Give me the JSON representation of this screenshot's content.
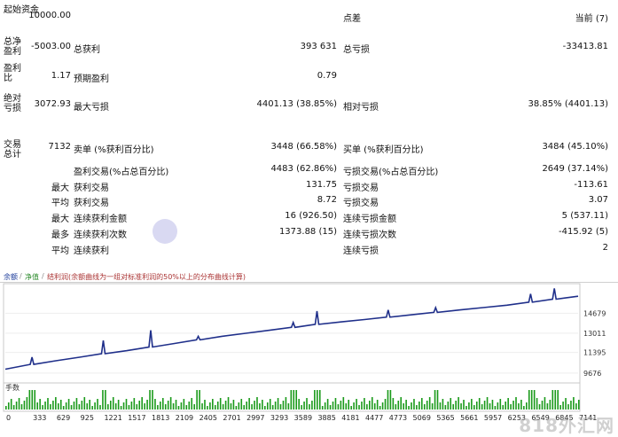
{
  "report": {
    "rows": [
      {
        "label": "起始资金",
        "value": "10000.00",
        "label2": "点差",
        "value2": "当前 (7)"
      },
      {
        "label": "总净盈利",
        "value": "-5003.00",
        "mid_label": "总获利",
        "mid_value": "393 631",
        "label2": "总亏损",
        "value2": "-33413.81"
      },
      {
        "label": "盈利比",
        "value": "1.17",
        "mid_label": "预期盈利",
        "mid_value": "0.79"
      },
      {
        "label": "绝对亏损",
        "value": "3072.93",
        "mid_label": "最大亏损",
        "mid_value": "4401.13 (38.85%)",
        "label2": "相对亏损",
        "value2": "38.85% (4401.13)"
      },
      {
        "label": "交易总计",
        "value": "7132",
        "mid_label": "卖单 (%获利百分比)",
        "mid_value": "3448 (66.58%)",
        "label2": "买单 (%获利百分比)",
        "value2": "3484 (45.10%)"
      }
    ],
    "trade_rows": [
      {
        "prefix": "",
        "mid_label": "盈利交易(%占总百分比)",
        "mid_value": "4483 (62.86%)",
        "label2": "亏损交易(%占总百分比)",
        "value2": "2649 (37.14%)"
      },
      {
        "prefix": "最大",
        "mid_label": "获利交易",
        "mid_value": "131.75",
        "label2": "亏损交易",
        "value2": "-113.61"
      },
      {
        "prefix": "平均",
        "mid_label": "获利交易",
        "mid_value": "8.72",
        "label2": "亏损交易",
        "value2": "3.07"
      },
      {
        "prefix": "最大",
        "mid_label": "连续获利金额",
        "mid_value": "16 (926.50)",
        "label2": "连续亏损金额",
        "value2": "5 (537.11)"
      },
      {
        "prefix": "最多",
        "mid_label": "连续获利次数",
        "mid_value": "1373.88 (15)",
        "label2": "连续亏损次数",
        "value2": "-415.92 (5)"
      },
      {
        "prefix": "平均",
        "mid_label": "连续获利",
        "mid_value": "",
        "label2": "连续亏损",
        "value2": "2"
      }
    ]
  },
  "chart": {
    "tabs": [
      "余额",
      "/",
      "净值",
      "/",
      "结利润(余额曲线为一组对标准利润的50%以上的分布曲线计算)"
    ],
    "volume_label": "手数",
    "watermark": "818外汇网"
  },
  "chart_data": {
    "type": "line",
    "title": "",
    "xlabel": "",
    "ylabel": "",
    "x_ticks": [
      "0",
      "333",
      "629",
      "925",
      "1221",
      "1517",
      "1813",
      "2109",
      "2405",
      "2701",
      "2997",
      "3293",
      "3589",
      "3885",
      "4181",
      "4477",
      "4773",
      "5069",
      "5365",
      "5661",
      "5957",
      "6253",
      "6549",
      "6845",
      "7141"
    ],
    "y_ticks": [
      "14679",
      "13011",
      "11395",
      "9676"
    ],
    "ylim": [
      9000,
      17000
    ],
    "series": [
      {
        "name": "余额",
        "x": [
          0,
          333,
          629,
          925,
          1221,
          1517,
          1813,
          2109,
          2405,
          2701,
          2997,
          3293,
          3589,
          3885,
          4181,
          4477,
          4773,
          5069,
          5365,
          5661,
          5957,
          6253,
          6549,
          6845,
          7141
        ],
        "values": [
          10000,
          10400,
          10700,
          11000,
          11300,
          11550,
          11850,
          12150,
          12450,
          12750,
          13000,
          13250,
          13500,
          13750,
          13950,
          14150,
          14350,
          14550,
          14750,
          14950,
          15150,
          15350,
          15600,
          15850,
          16100
        ]
      }
    ],
    "spikes": [
      {
        "x": 333,
        "height": 600
      },
      {
        "x": 1221,
        "height": 1100
      },
      {
        "x": 1813,
        "height": 1400
      },
      {
        "x": 2405,
        "height": 300
      },
      {
        "x": 3589,
        "height": 400
      },
      {
        "x": 3885,
        "height": 1100
      },
      {
        "x": 4773,
        "height": 600
      },
      {
        "x": 5365,
        "height": 400
      },
      {
        "x": 6549,
        "height": 700
      },
      {
        "x": 6845,
        "height": 900
      }
    ]
  }
}
